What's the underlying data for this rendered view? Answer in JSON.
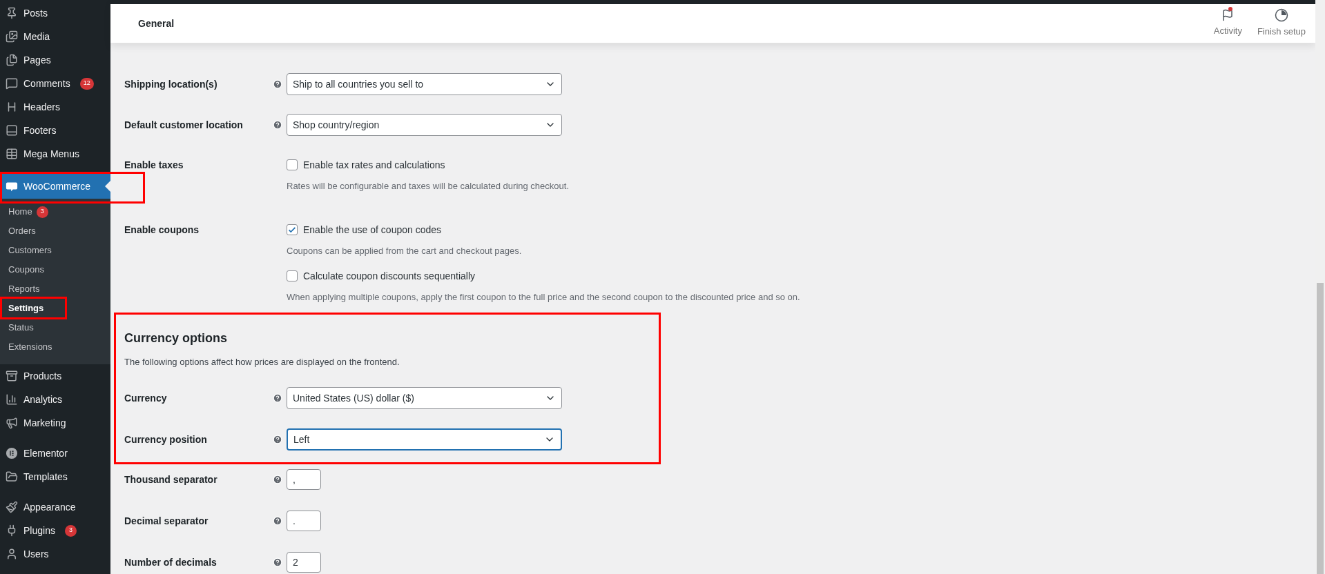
{
  "sidebar": {
    "groups": [
      [
        {
          "label": "Posts",
          "selected": false
        },
        {
          "label": "Media",
          "selected": false
        },
        {
          "label": "Pages",
          "selected": false
        },
        {
          "label": "Comments",
          "selected": false,
          "badge": "12"
        },
        {
          "label": "Headers",
          "selected": false
        },
        {
          "label": "Footers",
          "selected": false
        },
        {
          "label": "Mega Menus",
          "selected": false
        }
      ],
      [
        {
          "label": "WooCommerce",
          "selected": true,
          "highlighted": true,
          "children": [
            {
              "label": "Home",
              "selected": false,
              "highlighted": false,
              "badge": "3"
            },
            {
              "label": "Orders",
              "selected": false,
              "highlighted": false
            },
            {
              "label": "Customers",
              "selected": false,
              "highlighted": false
            },
            {
              "label": "Coupons",
              "selected": false,
              "highlighted": false
            },
            {
              "label": "Reports",
              "selected": false,
              "highlighted": false
            },
            {
              "label": "Settings",
              "selected": true,
              "highlighted": true
            },
            {
              "label": "Status",
              "selected": false,
              "highlighted": false
            },
            {
              "label": "Extensions",
              "selected": false,
              "highlighted": false
            }
          ]
        },
        {
          "label": "Products",
          "selected": false
        },
        {
          "label": "Analytics",
          "selected": false
        },
        {
          "label": "Marketing",
          "selected": false
        }
      ],
      [
        {
          "label": "Elementor",
          "selected": false
        },
        {
          "label": "Templates",
          "selected": false
        }
      ],
      [
        {
          "label": "Appearance",
          "selected": false
        },
        {
          "label": "Plugins",
          "selected": false,
          "badge": "3"
        },
        {
          "label": "Users",
          "selected": false
        }
      ]
    ]
  },
  "header": {
    "title": "General",
    "actions": [
      {
        "label": "Activity",
        "unread": true
      },
      {
        "label": "Finish setup"
      }
    ]
  },
  "settings": [
    {
      "kind": "select",
      "label": "Shipping location(s)",
      "value": "Ship to all countries you sell to",
      "focused": false
    },
    {
      "kind": "select",
      "label": "Default customer location",
      "value": "Shop country/region",
      "focused": false
    },
    {
      "kind": "checkboxes",
      "label": "Enable taxes",
      "options": [
        {
          "label": "Enable tax rates and calculations",
          "checked": false,
          "description": "Rates will be configurable and taxes will be calculated during checkout."
        }
      ]
    },
    {
      "kind": "checkboxes",
      "label": "Enable coupons",
      "options": [
        {
          "label": "Enable the use of coupon codes",
          "checked": true,
          "description": "Coupons can be applied from the cart and checkout pages."
        },
        {
          "label": "Calculate coupon discounts sequentially",
          "checked": false,
          "description": "When applying multiple coupons, apply the first coupon to the full price and the second coupon to the discounted price and so on."
        }
      ]
    }
  ],
  "currency_section": {
    "title": "Currency options",
    "description": "The following options affect how prices are displayed on the frontend.",
    "highlighted": true,
    "fields": [
      {
        "kind": "select",
        "label": "Currency",
        "value": "United States (US) dollar ($)",
        "focused": false
      },
      {
        "kind": "select",
        "label": "Currency position",
        "value": "Left",
        "focused": true
      }
    ]
  },
  "separators": [
    {
      "kind": "text",
      "label": "Thousand separator",
      "value": ","
    },
    {
      "kind": "text",
      "label": "Decimal separator",
      "value": "."
    },
    {
      "kind": "text",
      "label": "Number of decimals",
      "value": "2"
    }
  ]
}
